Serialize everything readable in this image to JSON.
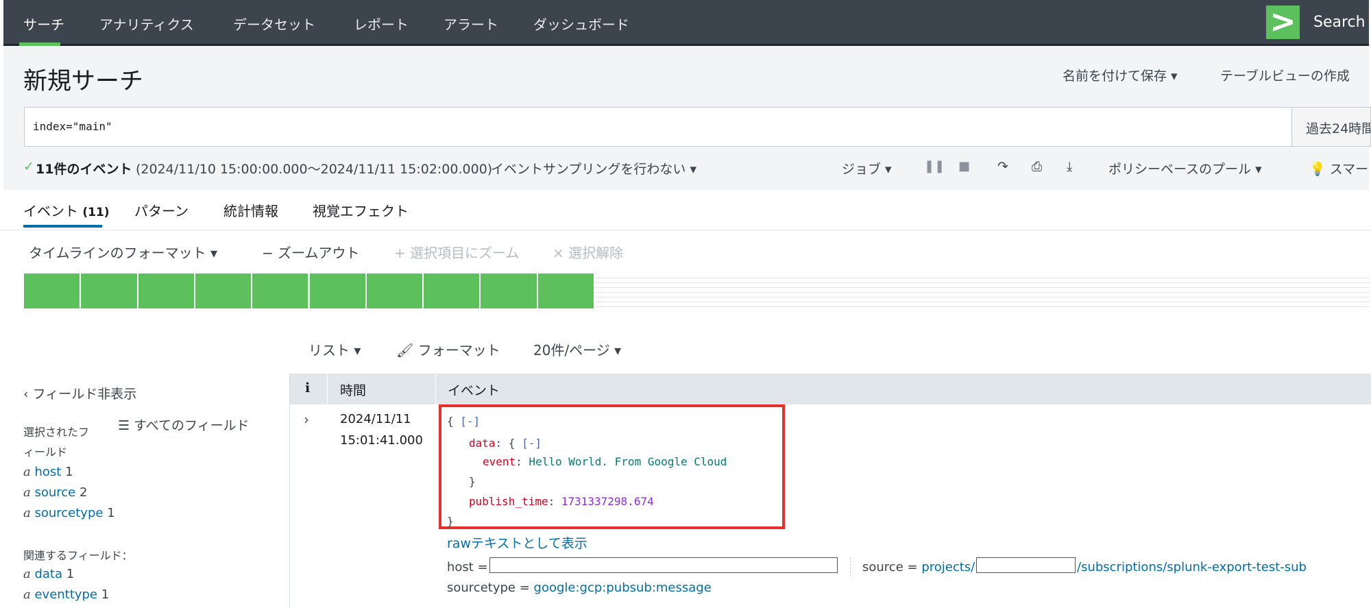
{
  "nav": {
    "items": [
      "サーチ",
      "アナリティクス",
      "データセット",
      "レポート",
      "アラート",
      "ダッシュボード"
    ],
    "logo": ">",
    "brand": "Search"
  },
  "header": {
    "title": "新規サーチ",
    "save_as": "名前を付けて保存 ▾",
    "create_table": "テーブルビューの作成"
  },
  "search": {
    "query": "index=\"main\"",
    "time_range": "過去24時間"
  },
  "status": {
    "check": "✓",
    "count": "11件のイベント",
    "range": "(2024/11/10 15:00:00.000〜2024/11/11 15:02:00.000)",
    "sampling": "イベントサンプリングを行わない ▾",
    "job": "ジョブ ▾",
    "pool": "ポリシーベースのプール ▾",
    "smart": "スマー"
  },
  "tabs": {
    "events": "イベント",
    "events_count": "(11)",
    "patterns": "パターン",
    "stats": "統計情報",
    "visual": "視覚エフェクト"
  },
  "timeline": {
    "format": "タイムラインのフォーマット ▾",
    "zoom_out": "− ズームアウト",
    "zoom_sel": "+ 選択項目にズーム",
    "deselect": "× 選択解除",
    "bars": 10,
    "color": "#5cc05c"
  },
  "list": {
    "view": "リスト ▾",
    "format": "フォーマット",
    "per_page": "20件/ページ ▾"
  },
  "fields": {
    "hide": "フィールド非表示",
    "all": "すべてのフィールド",
    "selected_label": "選択されたフィールド",
    "selected": [
      {
        "type": "a",
        "name": "host",
        "count": "1"
      },
      {
        "type": "a",
        "name": "source",
        "count": "2"
      },
      {
        "type": "a",
        "name": "sourcetype",
        "count": "1"
      }
    ],
    "related_label": "関連するフィールド：",
    "related": [
      {
        "type": "a",
        "name": "data",
        "count": "1"
      },
      {
        "type": "a",
        "name": "eventtype",
        "count": "1"
      }
    ]
  },
  "table": {
    "col_i": "i",
    "col_time": "時間",
    "col_event": "イベント"
  },
  "event": {
    "date": "2024/11/11",
    "time": "15:01:41.000",
    "collapse": "[-]",
    "key_data": "data",
    "key_event": "event",
    "val_event": "Hello World. From Google Cloud",
    "key_publish": "publish_time",
    "val_publish": "1731337298.674",
    "raw_link": "rawテキストとして表示",
    "host_label": "host =",
    "source_label": "source =",
    "source_prefix": "projects/",
    "source_suffix": "/subscriptions/splunk-export-test-sub",
    "sourcetype_label": "sourcetype =",
    "sourcetype_value": "google:gcp:pubsub:message"
  }
}
